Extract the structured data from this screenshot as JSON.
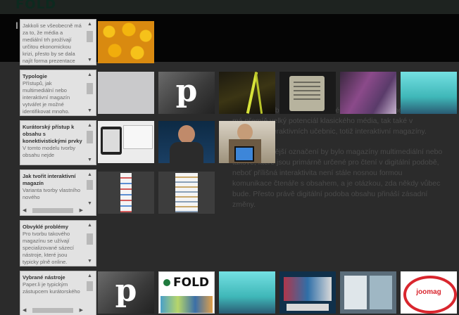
{
  "brand": {
    "logo": "FOLD",
    "header_char": "I"
  },
  "chapters": [
    {
      "title": "",
      "text": "Jakkoli se všeobecně má za to, že média a mediální trh prožívají určitou ekonomickou krizi, přesto by se dala najít forma prezentace obsahu"
    },
    {
      "title": "Typologie",
      "text": "Přístupů, jak multimediální nebo interaktivní magazín vytvářet je možné identifikovat mnoho."
    },
    {
      "title": "Kurátorský přístup k obsahu s konektivistickými prvky",
      "text": "V tomto modelu tvorby obsahu nejde"
    },
    {
      "title": "Jak tvořit interaktivní magazín",
      "text": "Varianta tvorby vlastního nového"
    },
    {
      "title": "Obvyklé problémy",
      "text": "Pro tvorbu takového magazínu se užívají specializované sázecí nástroje, které jsou typicky plně online."
    },
    {
      "title": "Vybrané nástroje",
      "text": "Paper.li je typickým zástupcem kurátorského"
    }
  ],
  "article": {
    "p1": "prezentace obsahu, která na své popularitě se o médium, které má přemíě velký potenciál klasického média, tak také v učebních interaktivních učebnic, totiž interaktivní magazíny.",
    "p2": "Možná přesnější označení by bylo magazíny multimediální nebo takové, které jsou primárně určené pro čtení v digitální podobě, neboť přílišná interaktivita není stále nosnou formou komunikace čtenáře s obsahem, a je otázkou, zda někdy vůbec bude. Přesto právě digitální podoba obsahu přináší zásadní změny."
  },
  "tiles": {
    "p_letter": "p",
    "fold_logo": "FOLD",
    "joomag": "joomag"
  },
  "colors": {
    "bg": "#2b2b2b",
    "panel": "#e2e2e2",
    "header": "#050505"
  }
}
